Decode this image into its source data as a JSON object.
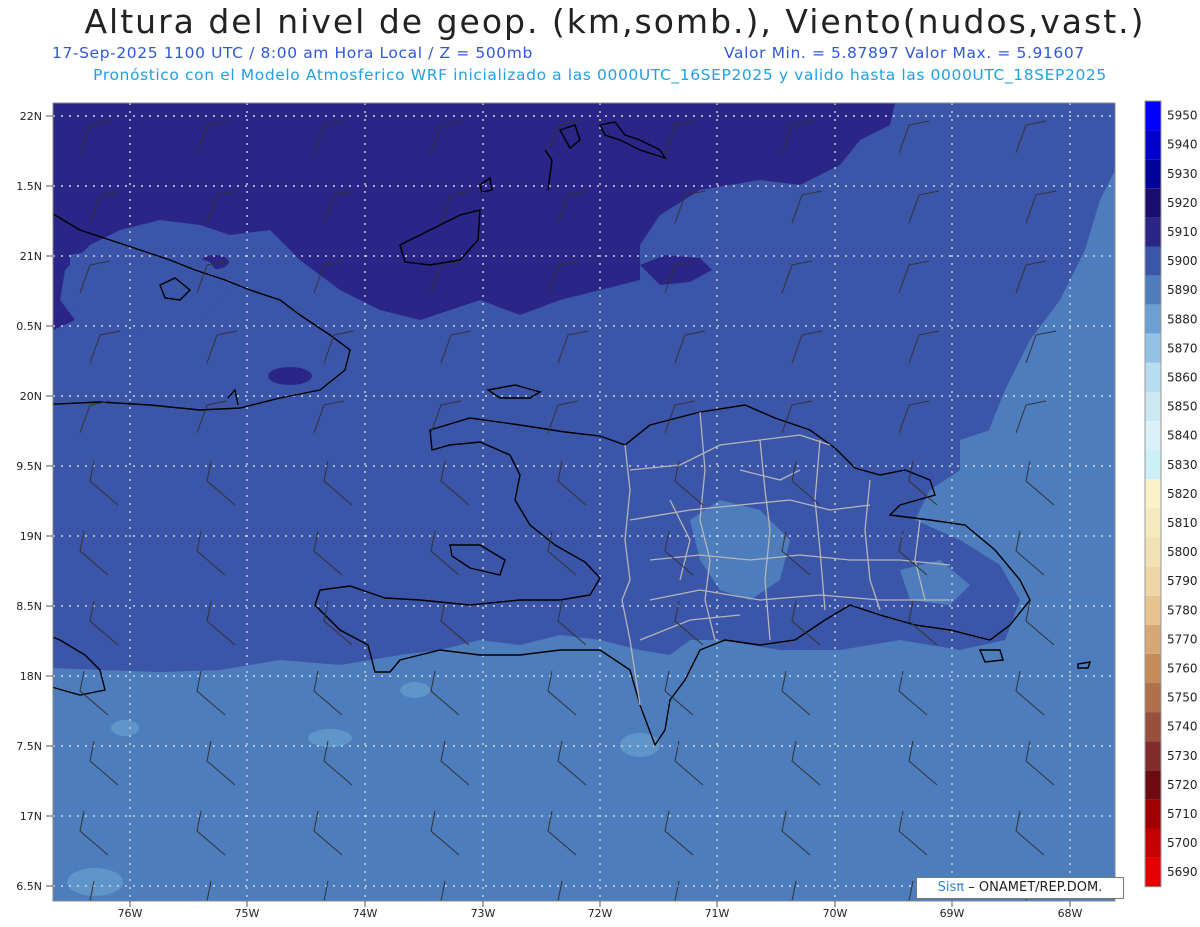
{
  "header": {
    "title": "Altura del nivel de geop. (km,somb.), Viento(nudos,vast.)",
    "datetime": "17-Sep-2025  1100 UTC / 8:00 am Hora Local / Z = 500mb",
    "minmax": "Valor Min. = 5.87897  Valor Max. = 5.91607",
    "model_info": "Pronóstico con el Modelo Atmosferico WRF inicializado a las 0000UTC_16SEP2025 y valido hasta las  0000UTC_18SEP2025"
  },
  "colors": {
    "title": "#222222",
    "datetime": "#2f58d8",
    "model_info": "#1ea1e6",
    "field_high": "#2a2587",
    "field_mid": "#3b55a9",
    "field_low": "#4d7dbd",
    "field_lowest": "#5f95c8",
    "coastline": "#000000",
    "provinces": "#b5b5b5",
    "grid": "#d0d0d0"
  },
  "axes": {
    "lat_labels": [
      "22N",
      "1.5N",
      "21N",
      "0.5N",
      "20N",
      "9.5N",
      "19N",
      "8.5N",
      "18N",
      "7.5N",
      "17N",
      "6.5N"
    ],
    "lon_labels": [
      "76W",
      "75W",
      "74W",
      "73W",
      "72W",
      "71W",
      "70W",
      "69W",
      "68W"
    ]
  },
  "colorbar": {
    "levels": [
      5950,
      5940,
      5930,
      5920,
      5910,
      5900,
      5890,
      5880,
      5870,
      5860,
      5850,
      5840,
      5830,
      5820,
      5810,
      5800,
      5790,
      5780,
      5770,
      5760,
      5750,
      5740,
      5730,
      5720,
      5710,
      5700,
      5690
    ],
    "colors": [
      "#0000ff",
      "#0000cc",
      "#00009a",
      "#1a0d6e",
      "#2a2587",
      "#3b55a9",
      "#4d7dbd",
      "#6c9fd2",
      "#92c3e6",
      "#b6def0",
      "#cbe8f3",
      "#dbf0f7",
      "#cdeff8",
      "#fbf2c9",
      "#f6e9bd",
      "#f2e1b2",
      "#efd6a5",
      "#e6c38f",
      "#d7a875",
      "#c58b59",
      "#b0704a",
      "#98503c",
      "#832a2a",
      "#6e0a12",
      "#a00000",
      "#c50000",
      "#e40000"
    ]
  },
  "credit": {
    "sis": "Sisπ",
    "org": "– ONAMET/REP.DOM."
  }
}
